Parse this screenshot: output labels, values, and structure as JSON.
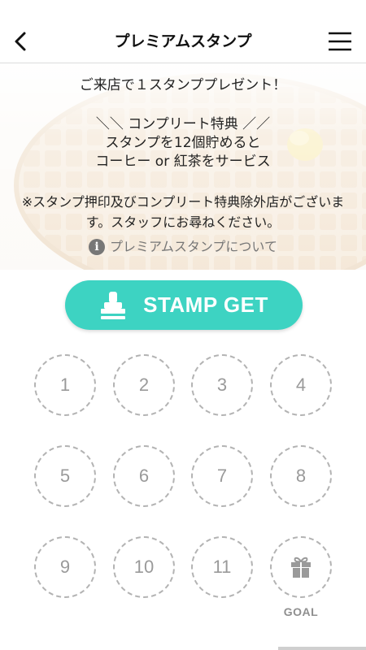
{
  "header": {
    "title": "プレミアムスタンプ"
  },
  "info": {
    "intro": "ご来店で１スタンププレゼント！",
    "complete_heading": "＼＼ コンプリート特典 ／／",
    "complete_line1": "スタンプを12個貯めると",
    "complete_line2": "コーヒー or 紅茶をサービス",
    "notice": "※スタンプ押印及びコンプリート特典除外店がございます。スタッフにお尋ねください。",
    "about_link": "プレミアムスタンプについて"
  },
  "stamp_button": {
    "label": "STAMP GET"
  },
  "stamp_card": {
    "slots": [
      "1",
      "2",
      "3",
      "4",
      "5",
      "6",
      "7",
      "8",
      "9",
      "10",
      "11"
    ],
    "goal_label": "GOAL",
    "goal_icon": "gift-icon"
  },
  "colors": {
    "accent": "#3dd3c2",
    "slot_border": "#b3b3b3",
    "slot_text": "#9a9a9a"
  }
}
